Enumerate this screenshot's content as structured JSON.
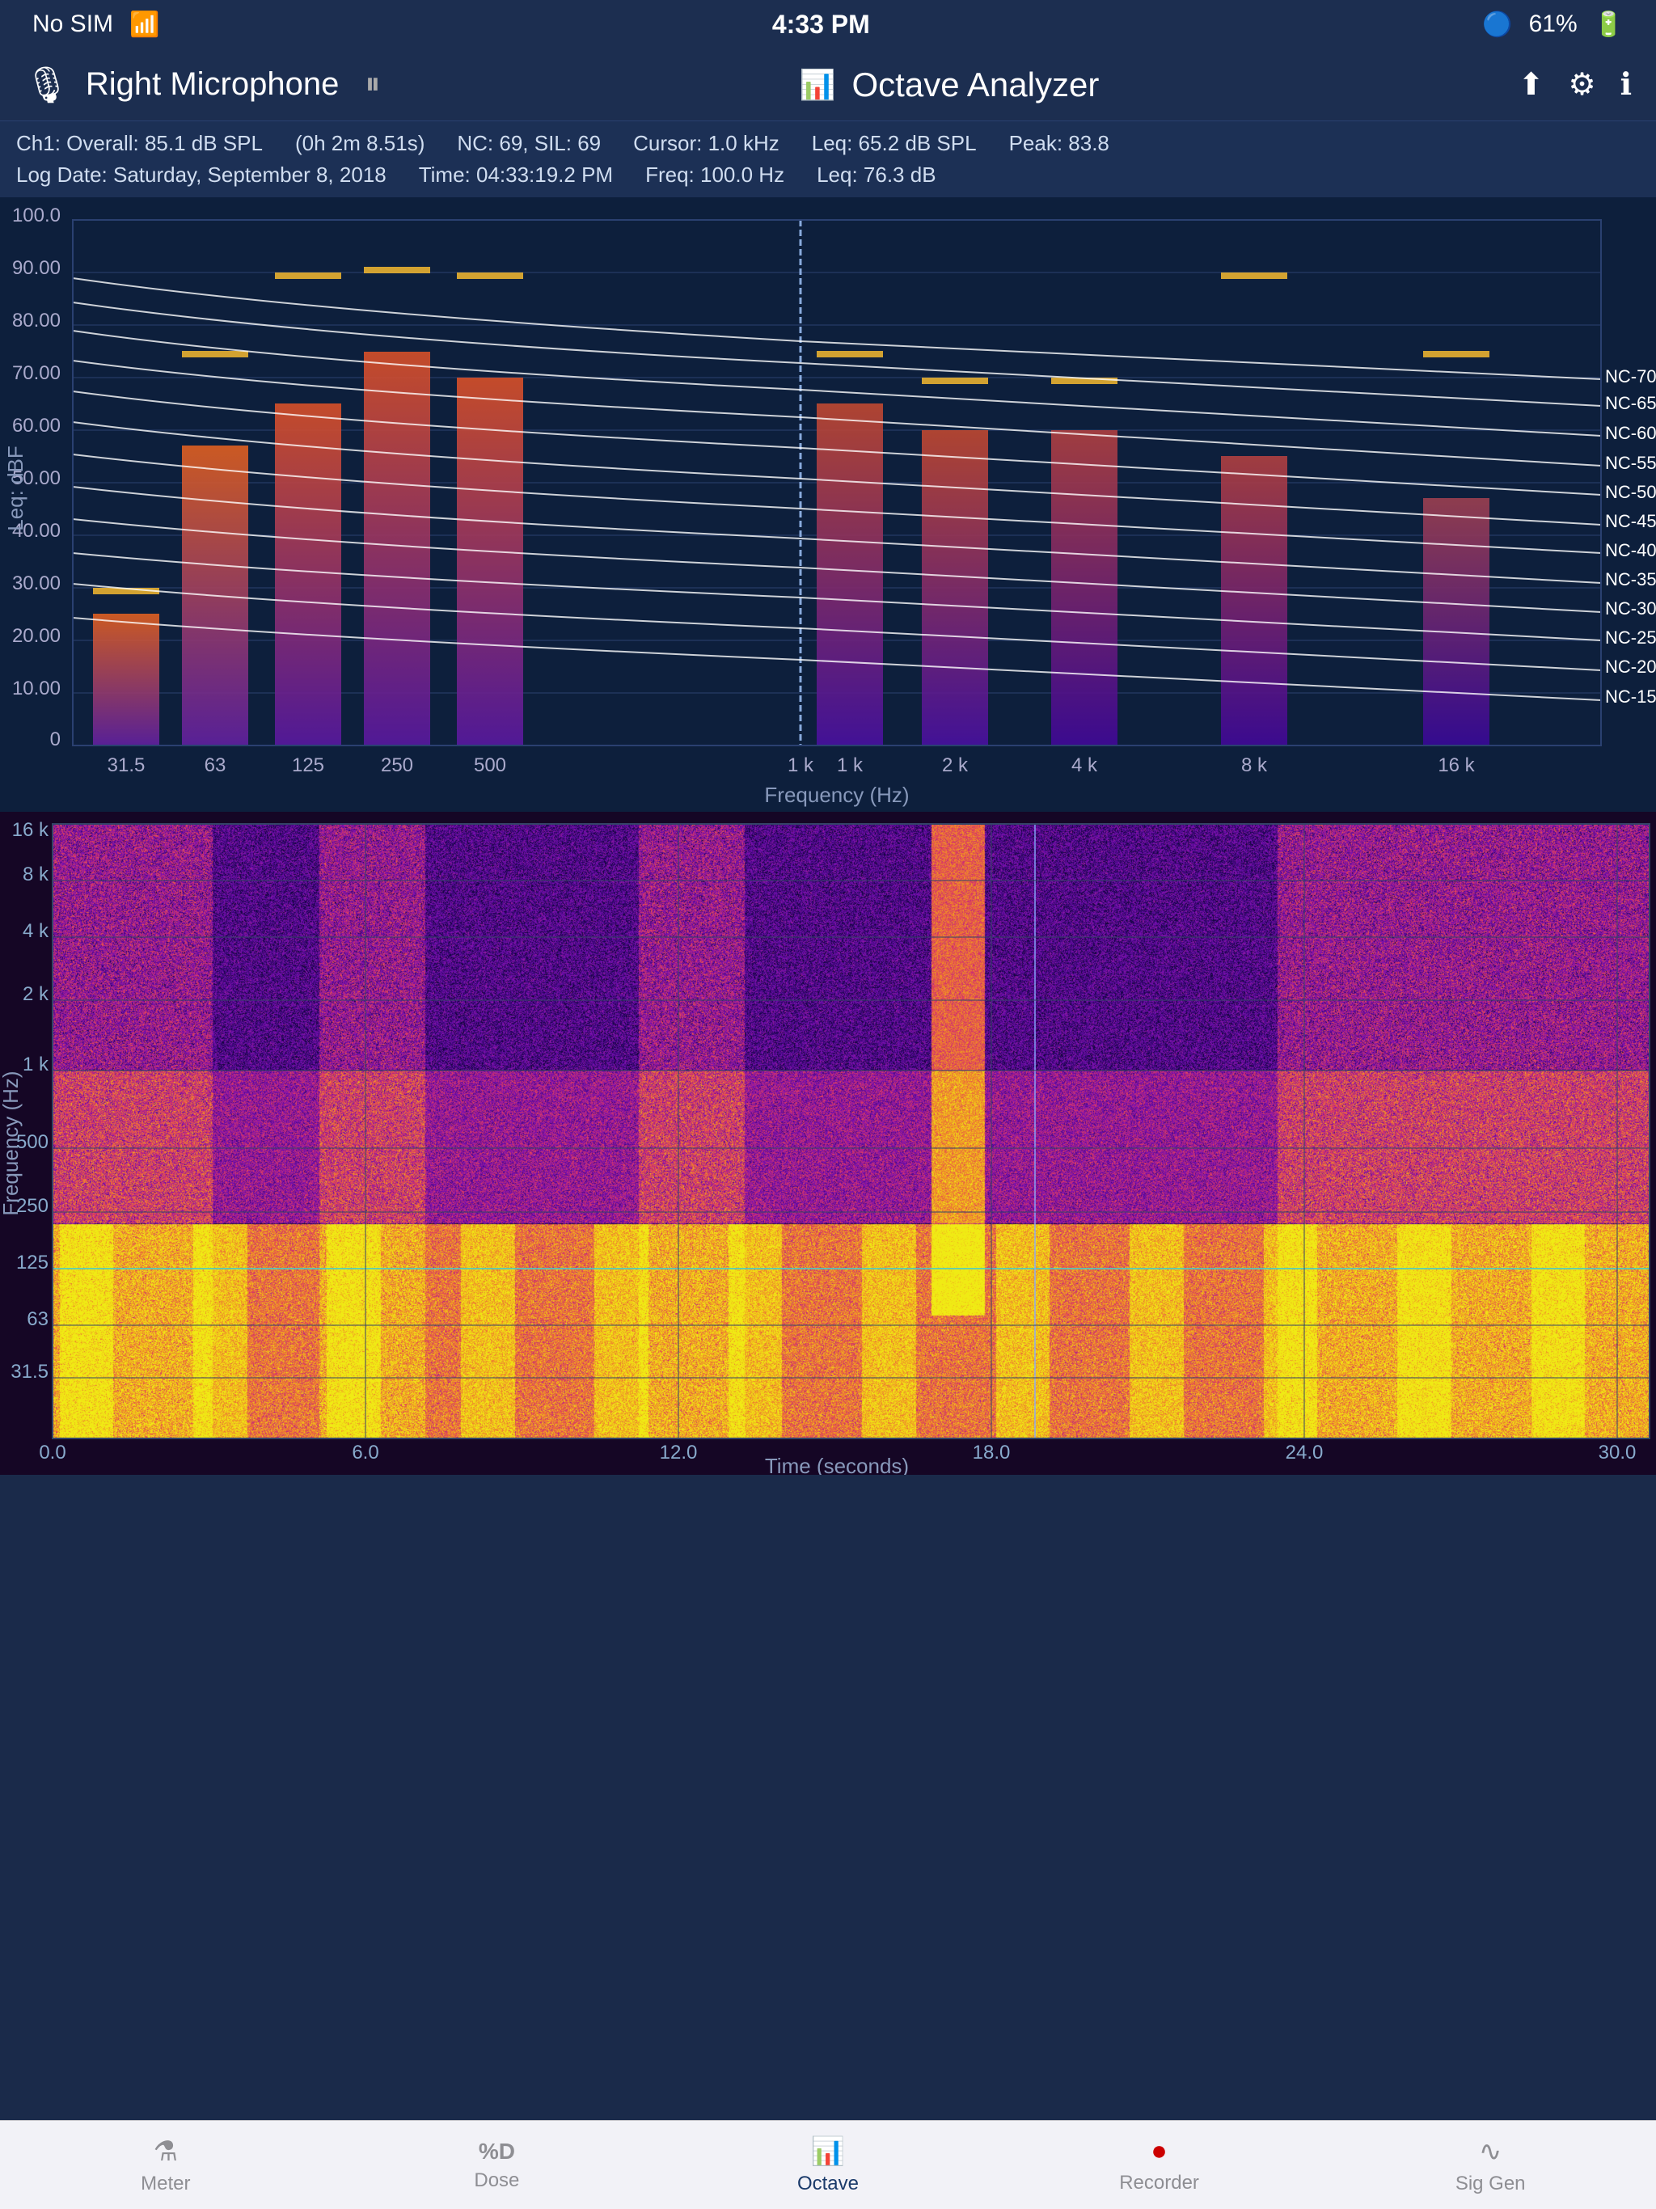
{
  "status_bar": {
    "carrier": "No SIM",
    "wifi_icon": "wifi",
    "time": "4:33 PM",
    "bluetooth_icon": "bluetooth",
    "battery": "61%"
  },
  "header": {
    "mic_label": "Right Microphone",
    "pause_label": "⏸",
    "app_icon": "waveform",
    "app_title": "Octave Analyzer",
    "settings_icon": "gear",
    "info_icon": "info"
  },
  "info_bar": {
    "row1": {
      "ch1": "Ch1:  Overall: 85.1  dB SPL",
      "duration": "(0h  2m 8.51s)",
      "nc": "NC: 69, SIL: 69",
      "cursor": "Cursor: 1.0 kHz",
      "leq": "Leq: 65.2 dB SPL",
      "peak": "Peak: 83.8"
    },
    "row2": {
      "log_date": "Log Date: Saturday, September 8, 2018",
      "time": "Time: 04:33:19.2 PM",
      "freq": "Freq: 100.0 Hz",
      "leq": "Leq: 76.3 dB"
    }
  },
  "octave_chart": {
    "y_axis_label": "Leq: dBF",
    "y_max": 100,
    "y_min": 0,
    "y_ticks": [
      100,
      90,
      80,
      70,
      60,
      50,
      40,
      30,
      20,
      10,
      0
    ],
    "x_axis_label": "Frequency (Hz)",
    "x_ticks": [
      "31.5",
      "63",
      "125",
      "250",
      "500",
      "1 k",
      "2 k",
      "4 k",
      "8 k",
      "16 k"
    ],
    "bars": [
      {
        "freq": "31.5",
        "leq": 25,
        "peak": 30,
        "color_top": "#e07020"
      },
      {
        "freq": "63",
        "leq": 57,
        "peak": 75,
        "color_top": "#e06030"
      },
      {
        "freq": "125",
        "leq": 65,
        "peak": 90,
        "color_top": "#e05030"
      },
      {
        "freq": "250",
        "leq": 75,
        "peak": 92,
        "color_top": "#e05530"
      },
      {
        "freq": "500",
        "leq": 70,
        "peak": 88,
        "color_top": "#d05530"
      },
      {
        "freq": "1k",
        "leq": 68,
        "peak": 85,
        "color_top": "#c05030"
      },
      {
        "freq": "2k",
        "leq": 62,
        "peak": 78,
        "color_top": "#b84040"
      },
      {
        "freq": "4k",
        "leq": 60,
        "peak": 75,
        "color_top": "#b04040"
      },
      {
        "freq": "8k",
        "leq": 55,
        "peak": 88,
        "color_top": "#a84040"
      },
      {
        "freq": "16k",
        "leq": 47,
        "peak": 75,
        "color_top": "#a04048"
      }
    ],
    "nc_curves": [
      "NC-70",
      "NC-65",
      "NC-60",
      "NC-55",
      "NC-50",
      "NC-45",
      "NC-40",
      "NC-35",
      "NC-30",
      "NC-25",
      "NC-20",
      "NC-15"
    ],
    "cursor_freq": "1 kHz"
  },
  "spectrogram": {
    "y_axis_label": "Frequency (Hz)",
    "y_ticks": [
      "16 k",
      "8 k",
      "4 k",
      "2 k",
      "1 k",
      "500",
      "250",
      "125",
      "63",
      "31.5"
    ],
    "x_axis_label": "Time (seconds)",
    "x_ticks": [
      "0.0",
      "6.0",
      "12.0",
      "18.0",
      "24.0",
      "30.0"
    ],
    "cursor_time": "18.0",
    "cursor_freq": "125"
  },
  "tab_bar": {
    "tabs": [
      {
        "id": "meter",
        "icon": "⚗",
        "label": "Meter",
        "active": false
      },
      {
        "id": "dose",
        "icon": "%D",
        "label": "Dose",
        "active": false
      },
      {
        "id": "octave",
        "icon": "▋▊▉",
        "label": "Octave",
        "active": true
      },
      {
        "id": "recorder",
        "icon": "●",
        "label": "Recorder",
        "active": false
      },
      {
        "id": "siggen",
        "icon": "∿",
        "label": "Sig Gen",
        "active": false
      }
    ]
  }
}
